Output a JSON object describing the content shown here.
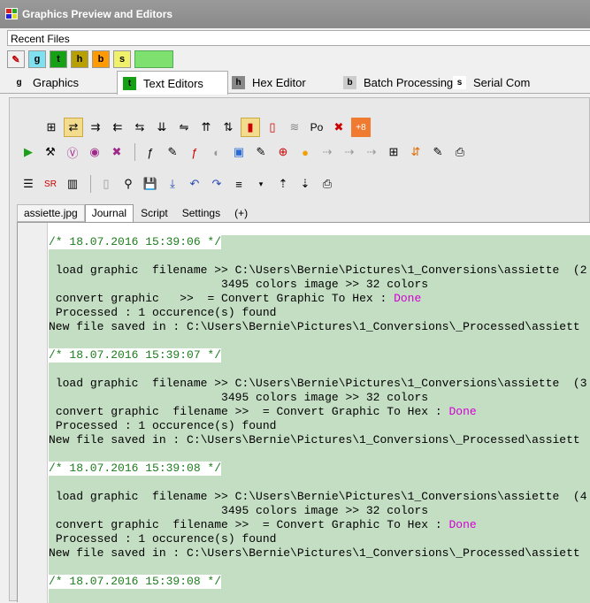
{
  "window": {
    "title": "Graphics Preview and Editors"
  },
  "recent_files": {
    "label": "Recent Files"
  },
  "quickbar": [
    {
      "icon": "no-edit-icon",
      "glyph": "✎",
      "bg": "#ffffff",
      "fg": "#c00000"
    },
    {
      "icon": "g-key-icon",
      "glyph": "g",
      "bg": "#7fe0f0",
      "fg": "#000000"
    },
    {
      "icon": "t-key-icon",
      "glyph": "t",
      "bg": "#16a016",
      "fg": "#000000"
    },
    {
      "icon": "h-key-icon",
      "glyph": "h",
      "bg": "#b8a000",
      "fg": "#000000"
    },
    {
      "icon": "b-key-icon",
      "glyph": "b",
      "bg": "#ff9a00",
      "fg": "#000000"
    },
    {
      "icon": "s-key-icon",
      "glyph": "s",
      "bg": "#f0f06a",
      "fg": "#000000"
    }
  ],
  "tabs": [
    {
      "label": "Graphics",
      "icon": "g"
    },
    {
      "label": "Text Editors",
      "icon": "t"
    },
    {
      "label": "Hex Editor",
      "icon": "h"
    },
    {
      "label": "Batch Processing",
      "icon": "b"
    },
    {
      "label": "Serial Com",
      "icon": "s"
    }
  ],
  "toolbar": {
    "row1": [
      "⊞",
      "⇄",
      "⇉",
      "⇇",
      "⇆",
      "⇊",
      "⇋",
      "⇈",
      "⇅",
      "▮",
      "▯",
      "≋",
      "Po",
      "✖",
      "+8"
    ],
    "row2": [
      "▶",
      "⚒",
      "Ⓥ",
      "◉",
      "✖",
      "ƒ",
      "✎",
      "ƒ",
      "◐",
      "▣",
      "✎",
      "⊕",
      "●",
      "⇢",
      "⇢",
      "⇢",
      "⊞",
      "⇵",
      "✎",
      "⎙"
    ],
    "row3": [
      "☰",
      "SR",
      "▥",
      "▯",
      "⚲",
      "💾",
      "⤓",
      "↶",
      "↷",
      "≡",
      "▾",
      "⇡",
      "⇣",
      "⎙"
    ]
  },
  "subtabs": [
    "assiette.jpg",
    "Journal",
    "Script",
    "Settings",
    "(+)"
  ],
  "journal": [
    {
      "ts": "/* 18.07.2016 15:39:06 */",
      "load": "load graphic  filename >> C:\\Users\\Bernie\\Pictures\\1_Conversions\\assiette  (2",
      "colors": "3495 colors image >> 32 colors",
      "convert": "convert graphic   >>  = Convert Graphic To Hex : ",
      "processed": "Processed : 1 occurence(s) found",
      "saved": "New file saved in : C:\\Users\\Bernie\\Pictures\\1_Conversions\\_Processed\\assiett"
    },
    {
      "ts": "/* 18.07.2016 15:39:07 */",
      "load": "load graphic  filename >> C:\\Users\\Bernie\\Pictures\\1_Conversions\\assiette  (3",
      "colors": "3495 colors image >> 32 colors",
      "convert": "convert graphic  filename >>  = Convert Graphic To Hex : ",
      "processed": "Processed : 1 occurence(s) found",
      "saved": "New file saved in : C:\\Users\\Bernie\\Pictures\\1_Conversions\\_Processed\\assiett"
    },
    {
      "ts": "/* 18.07.2016 15:39:08 */",
      "load": "load graphic  filename >> C:\\Users\\Bernie\\Pictures\\1_Conversions\\assiette  (4",
      "colors": "3495 colors image >> 32 colors",
      "convert": "convert graphic  filename >>  = Convert Graphic To Hex : ",
      "processed": "Processed : 1 occurence(s) found",
      "saved": "New file saved in : C:\\Users\\Bernie\\Pictures\\1_Conversions\\_Processed\\assiett"
    }
  ],
  "journal_tail_ts": "/* 18.07.2016 15:39:08 */",
  "done_label": "Done",
  "colors": {
    "code_bg": "#c4dec4",
    "timestamp": "#1c7d1c",
    "done": "#d000d0",
    "active_tool": "#f3dc8e"
  }
}
